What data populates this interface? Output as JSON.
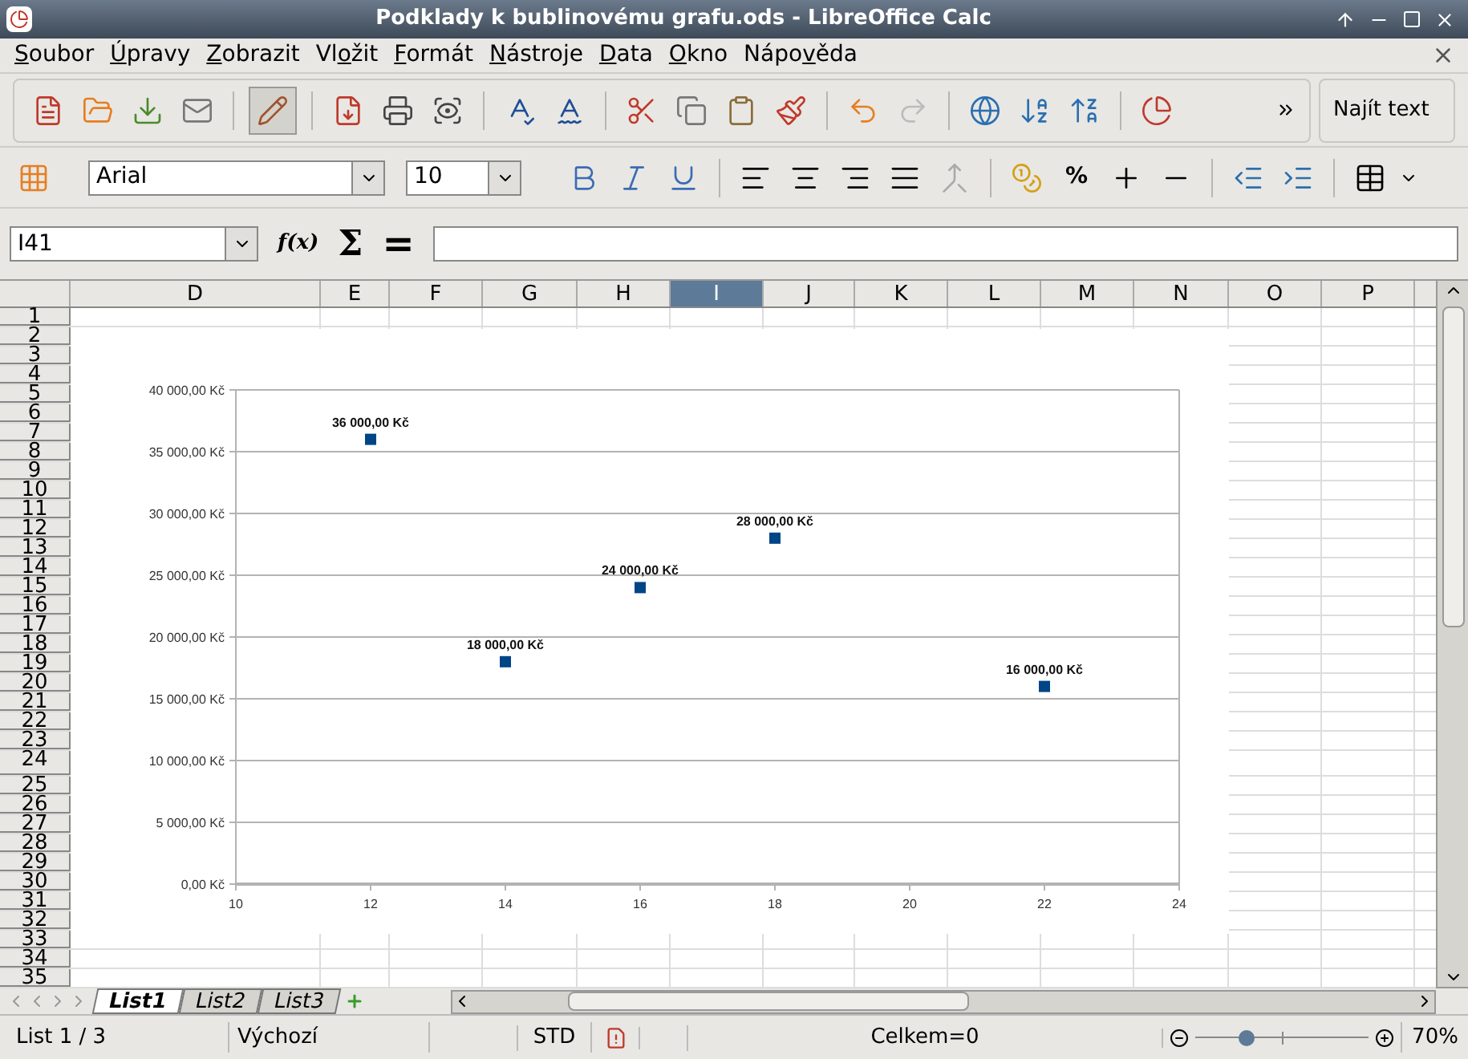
{
  "window": {
    "title": "Podklady k bublinovému grafu.ods - LibreOffice Calc"
  },
  "menu": [
    {
      "label": "Soubor"
    },
    {
      "label": "Úpravy"
    },
    {
      "label": "Zobrazit"
    },
    {
      "label": "Vložit"
    },
    {
      "label": "Formát"
    },
    {
      "label": "Nástroje"
    },
    {
      "label": "Data"
    },
    {
      "label": "Okno"
    },
    {
      "label": "Nápověda"
    }
  ],
  "find_toolbar": {
    "label": "Najít text"
  },
  "format_toolbar": {
    "font": "Arial",
    "size": "10",
    "percent": "%"
  },
  "formula_bar": {
    "cell": "I41",
    "function_wizard": "f(x)",
    "sum": "Σ",
    "equals": "="
  },
  "columns": [
    {
      "label": "D",
      "selected": false
    },
    {
      "label": "E",
      "selected": false
    },
    {
      "label": "F",
      "selected": false
    },
    {
      "label": "G",
      "selected": false
    },
    {
      "label": "H",
      "selected": false
    },
    {
      "label": "I",
      "selected": true
    },
    {
      "label": "J",
      "selected": false
    },
    {
      "label": "K",
      "selected": false
    },
    {
      "label": "L",
      "selected": false
    },
    {
      "label": "M",
      "selected": false
    },
    {
      "label": "N",
      "selected": false
    },
    {
      "label": "O",
      "selected": false
    },
    {
      "label": "P",
      "selected": false
    }
  ],
  "rows": [
    "1",
    "2",
    "3",
    "4",
    "5",
    "6",
    "7",
    "8",
    "9",
    "10",
    "11",
    "12",
    "13",
    "14",
    "15",
    "16",
    "17",
    "18",
    "19",
    "20",
    "21",
    "22",
    "23",
    "24",
    "25",
    "26",
    "27",
    "28",
    "29",
    "30",
    "31",
    "32",
    "33",
    "34",
    "35"
  ],
  "chart": {
    "chart_data": {
      "type": "scatter",
      "x": [
        12,
        14,
        16,
        18,
        22
      ],
      "grid": true,
      "series": [
        {
          "color": "#004586",
          "values": [
            36000,
            18000,
            24000,
            28000,
            16000
          ]
        }
      ],
      "xlim": [
        10,
        24
      ],
      "ylim": [
        0,
        40000
      ],
      "xticks": [
        10,
        12,
        14,
        16,
        18,
        20,
        22,
        24
      ],
      "yticks": [
        {
          "value": 0,
          "label": "0,00 Kč"
        },
        {
          "value": 5000,
          "label": "5 000,00 Kč"
        },
        {
          "value": 10000,
          "label": "10 000,00 Kč"
        },
        {
          "value": 15000,
          "label": "15 000,00 Kč"
        },
        {
          "value": 20000,
          "label": "20 000,00 Kč"
        },
        {
          "value": 25000,
          "label": "25 000,00 Kč"
        },
        {
          "value": 30000,
          "label": "30 000,00 Kč"
        },
        {
          "value": 35000,
          "label": "35 000,00 Kč"
        },
        {
          "value": 40000,
          "label": "40 000,00 Kč"
        }
      ],
      "value_labels": [
        "36 000,00 Kč",
        "18 000,00 Kč",
        "24 000,00 Kč",
        "28 000,00 Kč",
        "16 000,00 Kč"
      ]
    }
  },
  "sheet_tabs": [
    {
      "label": "List1",
      "selected": true
    },
    {
      "label": "List2",
      "selected": false
    },
    {
      "label": "List3",
      "selected": false
    }
  ],
  "status_bar": {
    "sheet": "List 1 / 3",
    "page_style": "Výchozí",
    "mode": "STD",
    "sum": "Celkem=0",
    "zoom": {
      "level": 0.3
    },
    "zoom_label": "70%"
  }
}
